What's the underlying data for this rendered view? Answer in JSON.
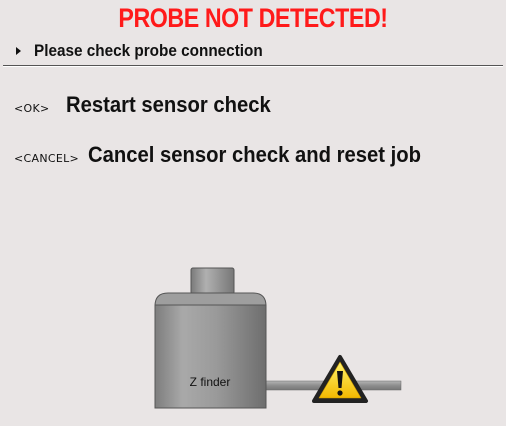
{
  "header": {
    "title": "PROBE NOT DETECTED!",
    "message": "Please check probe connection"
  },
  "options": [
    {
      "key": "<OK>",
      "label": "Restart sensor check"
    },
    {
      "key": "<CANCEL>",
      "label": "Cancel sensor check and reset job"
    }
  ],
  "illustration": {
    "device_label": "Z finder",
    "warning_icon": "warning-triangle-icon"
  },
  "colors": {
    "title": "#ff1a1a",
    "background": "#e9e5e5",
    "warning": "#ffd21a"
  }
}
